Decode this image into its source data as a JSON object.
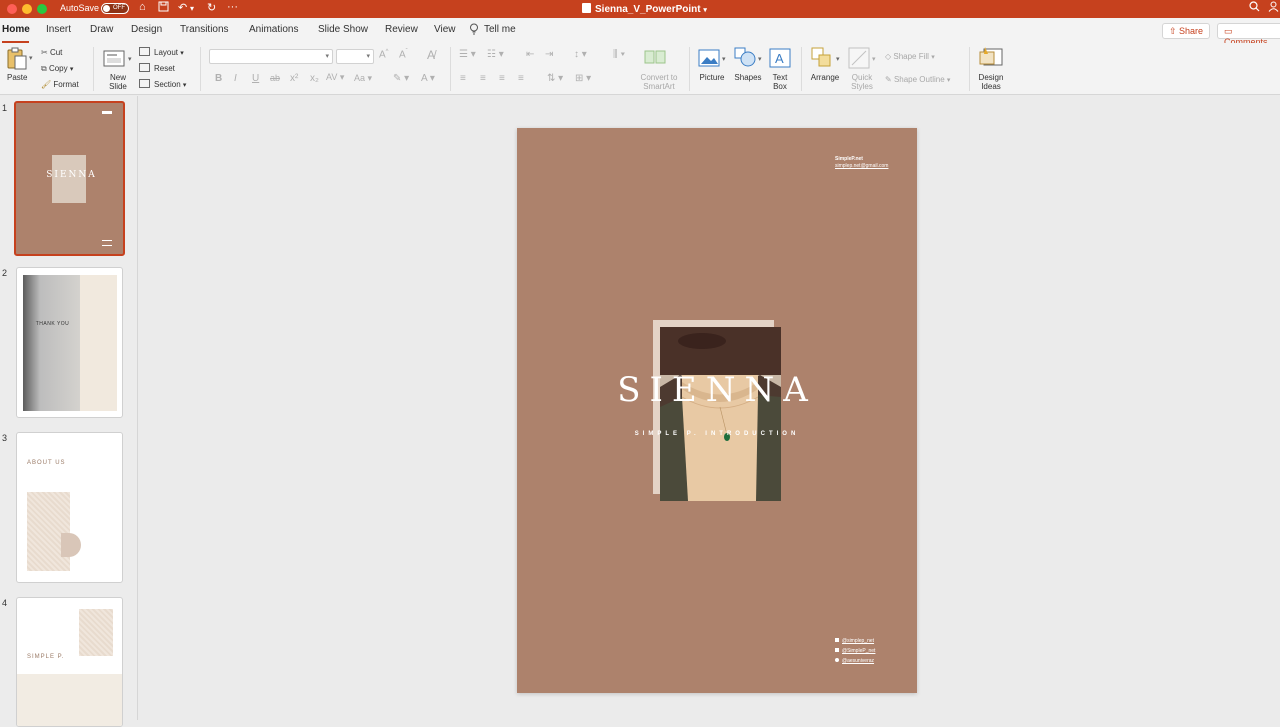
{
  "window": {
    "title": "Sienna_V_PowerPoint",
    "autosave_label": "AutoSave",
    "autosave_state": "OFF"
  },
  "tabs": [
    "Home",
    "Insert",
    "Draw",
    "Design",
    "Transitions",
    "Animations",
    "Slide Show",
    "Review",
    "View",
    "Tell me"
  ],
  "actions": {
    "share": "Share",
    "comments": "Comments"
  },
  "ribbon": {
    "paste": "Paste",
    "cut": "Cut",
    "copy": "Copy",
    "format": "Format",
    "new_slide": [
      "New",
      "Slide"
    ],
    "layout": "Layout",
    "reset": "Reset",
    "section": "Section",
    "convert_smartart": [
      "Convert to",
      "SmartArt"
    ],
    "picture": "Picture",
    "shapes": "Shapes",
    "text_box": [
      "Text",
      "Box"
    ],
    "arrange": "Arrange",
    "quick_styles": [
      "Quick",
      "Styles"
    ],
    "shape_fill": "Shape Fill",
    "shape_outline": "Shape Outline",
    "design_ideas": [
      "Design",
      "Ideas"
    ]
  },
  "thumbnails": {
    "numbers": [
      "1",
      "2",
      "3",
      "4"
    ],
    "slide2_text": "THANK YOU",
    "slide3_text": "ABOUT US",
    "slide4_text": "SIMPLE P."
  },
  "slide": {
    "title": "SIENNA",
    "subtitle": "SIMPLE P. INTRODUCTION",
    "brand": "SimpleP.net",
    "email": "simplep.net@gmail.com",
    "socials": [
      "@simplep_net",
      "@SimpleP_net",
      "@aesuniveraz"
    ]
  },
  "colors": {
    "accent": "#c6411e",
    "slide_bg": "#ad826c"
  }
}
